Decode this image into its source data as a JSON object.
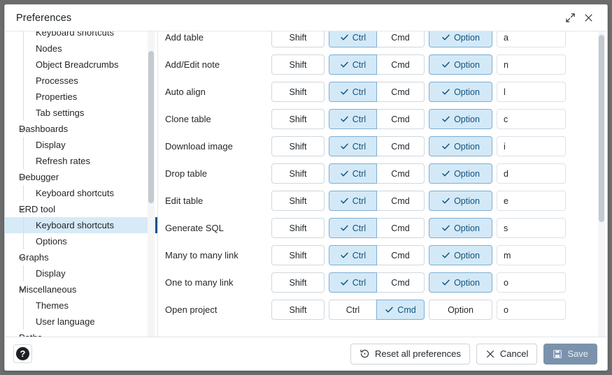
{
  "window": {
    "title": "Preferences",
    "maximize_icon": "expand-diagonal-icon",
    "close_icon": "close-icon"
  },
  "sidebar": {
    "scrollbar": "vertical-scrollbar",
    "items": [
      {
        "label": "Keyboard shortcuts",
        "level": "child",
        "expanded": null,
        "selected": false
      },
      {
        "label": "Nodes",
        "level": "child",
        "expanded": null,
        "selected": false
      },
      {
        "label": "Object Breadcrumbs",
        "level": "child",
        "expanded": null,
        "selected": false
      },
      {
        "label": "Processes",
        "level": "child",
        "expanded": null,
        "selected": false
      },
      {
        "label": "Properties",
        "level": "child",
        "expanded": null,
        "selected": false
      },
      {
        "label": "Tab settings",
        "level": "child",
        "expanded": null,
        "selected": false
      },
      {
        "label": "Dashboards",
        "level": "parent",
        "expanded": true,
        "selected": false
      },
      {
        "label": "Display",
        "level": "child",
        "expanded": null,
        "selected": false
      },
      {
        "label": "Refresh rates",
        "level": "child",
        "expanded": null,
        "selected": false
      },
      {
        "label": "Debugger",
        "level": "parent",
        "expanded": true,
        "selected": false
      },
      {
        "label": "Keyboard shortcuts",
        "level": "child",
        "expanded": null,
        "selected": false
      },
      {
        "label": "ERD tool",
        "level": "parent",
        "expanded": true,
        "selected": false
      },
      {
        "label": "Keyboard shortcuts",
        "level": "child",
        "expanded": null,
        "selected": true
      },
      {
        "label": "Options",
        "level": "child",
        "expanded": null,
        "selected": false
      },
      {
        "label": "Graphs",
        "level": "parent",
        "expanded": true,
        "selected": false
      },
      {
        "label": "Display",
        "level": "child",
        "expanded": null,
        "selected": false
      },
      {
        "label": "Miscellaneous",
        "level": "parent",
        "expanded": true,
        "selected": false
      },
      {
        "label": "Themes",
        "level": "child",
        "expanded": null,
        "selected": false
      },
      {
        "label": "User language",
        "level": "child",
        "expanded": null,
        "selected": false
      },
      {
        "label": "Paths",
        "level": "parent",
        "expanded": true,
        "selected": false
      }
    ]
  },
  "main": {
    "scrollbar": "vertical-scrollbar",
    "modifier_labels": {
      "shift": "Shift",
      "ctrl": "Ctrl",
      "cmd": "Cmd",
      "option": "Option"
    },
    "shortcuts": [
      {
        "action": "Add table",
        "shift": false,
        "ctrl": true,
        "cmd": false,
        "option": true,
        "key": "a"
      },
      {
        "action": "Add/Edit note",
        "shift": false,
        "ctrl": true,
        "cmd": false,
        "option": true,
        "key": "n"
      },
      {
        "action": "Auto align",
        "shift": false,
        "ctrl": true,
        "cmd": false,
        "option": true,
        "key": "l"
      },
      {
        "action": "Clone table",
        "shift": false,
        "ctrl": true,
        "cmd": false,
        "option": true,
        "key": "c"
      },
      {
        "action": "Download image",
        "shift": false,
        "ctrl": true,
        "cmd": false,
        "option": true,
        "key": "i"
      },
      {
        "action": "Drop table",
        "shift": false,
        "ctrl": true,
        "cmd": false,
        "option": true,
        "key": "d"
      },
      {
        "action": "Edit table",
        "shift": false,
        "ctrl": true,
        "cmd": false,
        "option": true,
        "key": "e"
      },
      {
        "action": "Generate SQL",
        "shift": false,
        "ctrl": true,
        "cmd": false,
        "option": true,
        "key": "s"
      },
      {
        "action": "Many to many link",
        "shift": false,
        "ctrl": true,
        "cmd": false,
        "option": true,
        "key": "m"
      },
      {
        "action": "One to many link",
        "shift": false,
        "ctrl": true,
        "cmd": false,
        "option": true,
        "key": "o"
      },
      {
        "action": "Open project",
        "shift": false,
        "ctrl": false,
        "cmd": true,
        "option": false,
        "key": "o"
      }
    ]
  },
  "footer": {
    "help_label": "?",
    "reset_label": "Reset all preferences",
    "reset_icon": "reset-clock-icon",
    "cancel_label": "Cancel",
    "cancel_icon": "close-icon",
    "save_label": "Save",
    "save_icon": "floppy-disk-icon"
  },
  "colors": {
    "accent": "#18548f",
    "checked_bg": "#d3e9f7",
    "checked_border": "#7daed4",
    "checked_text": "#12527f",
    "selection_bg": "#d7eaf7",
    "save_bg": "#7b92ad"
  }
}
